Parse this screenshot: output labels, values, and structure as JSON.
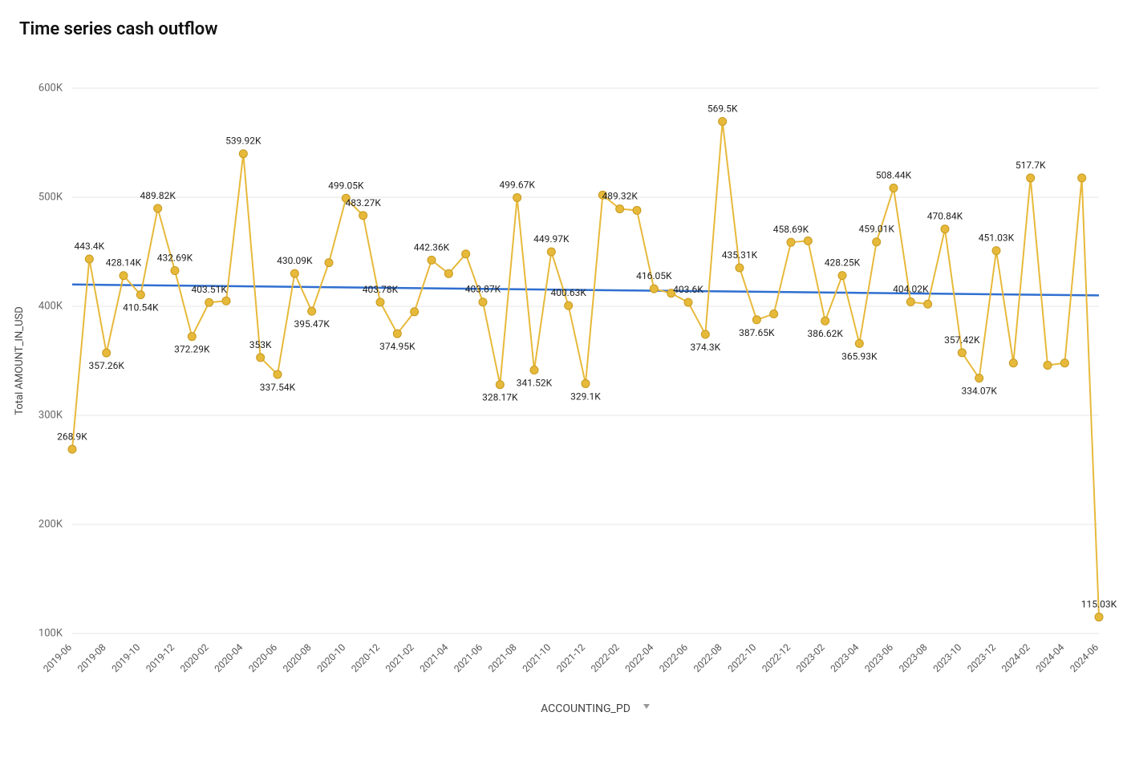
{
  "title": "Time series cash outflow",
  "y_axis_label": "Total AMOUNT_IN_USD",
  "x_axis_label": "ACCOUNTING_PD",
  "chart_data": {
    "type": "line",
    "xlabel": "ACCOUNTING_PD",
    "ylabel": "Total AMOUNT_IN_USD",
    "ylim": [
      100000,
      600000
    ],
    "y_ticks": [
      100000,
      200000,
      300000,
      400000,
      500000,
      600000
    ],
    "y_tick_labels": [
      "100K",
      "200K",
      "300K",
      "400K",
      "500K",
      "600K"
    ],
    "x_tick_labels": [
      "2019-06",
      "2019-08",
      "2019-10",
      "2019-12",
      "2020-02",
      "2020-04",
      "2020-06",
      "2020-08",
      "2020-10",
      "2020-12",
      "2021-02",
      "2021-04",
      "2021-06",
      "2021-08",
      "2021-10",
      "2021-12",
      "2022-02",
      "2022-04",
      "2022-06",
      "2022-08",
      "2022-10",
      "2022-12",
      "2023-02",
      "2023-04",
      "2023-06",
      "2023-08",
      "2023-10",
      "2023-12",
      "2024-02",
      "2024-04",
      "2024-06"
    ],
    "categories": [
      "2019-06",
      "2019-07",
      "2019-08",
      "2019-09",
      "2019-10",
      "2019-11",
      "2019-12",
      "2020-01",
      "2020-02",
      "2020-03",
      "2020-04",
      "2020-05",
      "2020-06",
      "2020-07",
      "2020-08",
      "2020-09",
      "2020-10",
      "2020-11",
      "2020-12",
      "2021-01",
      "2021-02",
      "2021-03",
      "2021-04",
      "2021-05",
      "2021-06",
      "2021-07",
      "2021-08",
      "2021-09",
      "2021-10",
      "2021-11",
      "2021-12",
      "2022-01",
      "2022-02",
      "2022-03",
      "2022-04",
      "2022-05",
      "2022-06",
      "2022-07",
      "2022-08",
      "2022-09",
      "2022-10",
      "2022-11",
      "2022-12",
      "2023-01",
      "2023-02",
      "2023-03",
      "2023-04",
      "2023-05",
      "2023-06",
      "2023-07",
      "2023-08",
      "2023-09",
      "2023-10",
      "2023-11",
      "2023-12",
      "2024-01",
      "2024-02",
      "2024-03",
      "2024-04",
      "2024-05",
      "2024-06"
    ],
    "series": [
      {
        "name": "Total AMOUNT_IN_USD",
        "values": [
          268900,
          443400,
          357260,
          428140,
          410540,
          489820,
          432690,
          372290,
          403510,
          405000,
          539920,
          353000,
          337540,
          430090,
          395470,
          440000,
          499050,
          483270,
          403780,
          374950,
          395000,
          442360,
          430000,
          448000,
          403870,
          328170,
          499670,
          341520,
          449970,
          400630,
          329100,
          502000,
          489320,
          488000,
          416050,
          412000,
          403600,
          374300,
          569500,
          435310,
          387650,
          393000,
          458690,
          460000,
          386620,
          428250,
          365930,
          459010,
          508440,
          404020,
          402000,
          470840,
          357420,
          334070,
          451030,
          348000,
          517700,
          346000,
          348000,
          517700,
          115030
        ]
      }
    ],
    "data_labels": [
      "268.9K",
      "443.4K",
      "357.26K",
      "428.14K",
      "410.54K",
      "489.82K",
      "432.69K",
      "372.29K",
      "403.51K",
      "",
      "539.92K",
      "353K",
      "337.54K",
      "430.09K",
      "395.47K",
      "",
      "499.05K",
      "483.27K",
      "403.78K",
      "374.95K",
      "",
      "442.36K",
      "",
      "",
      "403.87K",
      "328.17K",
      "499.67K",
      "341.52K",
      "449.97K",
      "400.63K",
      "329.1K",
      "",
      "489.32K",
      "",
      "416.05K",
      "",
      "403.6K",
      "374.3K",
      "569.5K",
      "435.31K",
      "387.65K",
      "",
      "458.69K",
      "",
      "386.62K",
      "428.25K",
      "365.93K",
      "459.01K",
      "508.44K",
      "404.02K",
      "",
      "470.84K",
      "357.42K",
      "334.07K",
      "451.03K",
      "",
      "517.7K",
      "",
      "",
      "",
      "115.03K"
    ],
    "trend": {
      "y_start": 420000,
      "y_end": 410000
    }
  }
}
